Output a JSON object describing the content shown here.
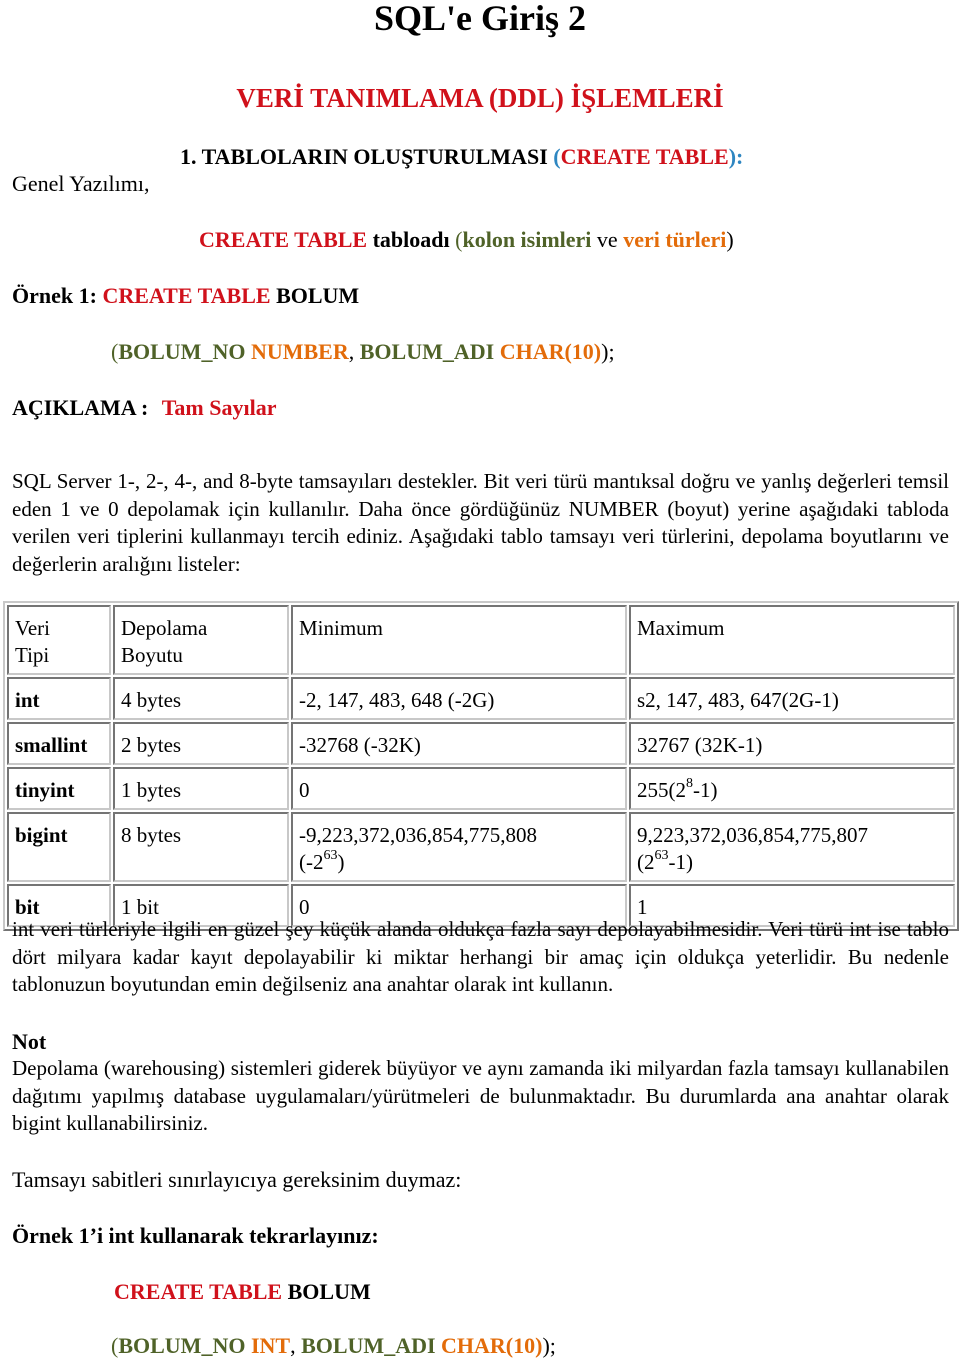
{
  "title": "SQL'e Giriş 2",
  "section_heading": "VERİ TANIMLAMA (DDL) İŞLEMLERİ",
  "subsection": {
    "number_text": "1. TABLOLARIN OLUŞTURULMASI ",
    "open_paren": "(",
    "keyword": "CREATE TABLE",
    "close_paren": ")",
    "colon": ":"
  },
  "general_syntax_label": "Genel Yazılımı,",
  "syntax": {
    "keyword": "CREATE TABLE",
    "table_word": " tabloadı ",
    "open_paren": "(",
    "columns_text": "kolon isimleri",
    "and_text": " ve ",
    "types_text": "veri türleri",
    "close_paren": ")"
  },
  "example1": {
    "label": "Örnek 1: ",
    "keyword": "CREATE TABLE",
    "table_name": " BOLUM",
    "line2": {
      "open_paren": "(",
      "col1": "BOLUM_NO",
      "type1": " NUMBER",
      "comma": ", ",
      "col2": "BOLUM_ADI",
      "type2": " CHAR(10)",
      "close": ");"
    }
  },
  "aciklama": {
    "label": "AÇIKLAMA : ",
    "value": "Tam Sayılar"
  },
  "paragraph1": "SQL Server 1-, 2-, 4-, and 8-byte tamsayıları destekler. Bit veri türü mantıksal doğru ve yanlış değerleri temsil eden 1 ve 0 depolamak için kullanılır. Daha önce gördüğünüz NUMBER (boyut) yerine aşağıdaki tabloda verilen veri tiplerini kullanmayı tercih ediniz. Aşağıdaki tablo tamsayı veri türlerini, depolama boyutlarını ve değerlerin aralığını listeler:",
  "table": {
    "headers": [
      "Veri Tipi",
      "Depolama Boyutu",
      "Minimum",
      "Maximum"
    ],
    "header_lines": [
      [
        "Veri",
        "Tipi"
      ],
      [
        "Depolama",
        "Boyutu"
      ],
      [
        "Minimum"
      ],
      [
        "Maximum"
      ]
    ],
    "rows": [
      {
        "type": "int",
        "size": "4 bytes",
        "min": "-2, 147, 483, 648 (-2G)",
        "max": "s2, 147, 483, 647(2G-1)"
      },
      {
        "type": "smallint",
        "size": "2 bytes",
        "min": "-32768 (-32K)",
        "max": "32767 (32K-1)"
      },
      {
        "type": "tinyint",
        "size": "1 bytes",
        "min": "0",
        "max_base": "255(2",
        "max_sup": "8",
        "max_tail": "-1)"
      },
      {
        "type": "bigint",
        "size": "8 bytes",
        "min_line1": "-9,223,372,036,854,775,808",
        "min_line2_base": "(-2",
        "min_line2_sup": "63",
        "min_line2_tail": ")",
        "max_line1": "9,223,372,036,854,775,807",
        "max_line2_base": "(2",
        "max_line2_sup": "63",
        "max_line2_tail": "-1)"
      },
      {
        "type": "bit",
        "size": "1 bit",
        "min": "0",
        "max": "1"
      }
    ]
  },
  "paragraph2": "int veri türleriyle ilgili en güzel şey küçük alanda oldukça fazla sayı depolayabilmesidir. Veri türü int ise tablo dört milyara kadar kayıt depolayabilir ki miktar herhangi bir amaç için oldukça yeterlidir. Bu nedenle tablonuzun boyutundan emin değilseniz ana anahtar olarak int kullanın.",
  "note": {
    "heading": "Not",
    "text": "Depolama (warehousing) sistemleri giderek büyüyor ve aynı zamanda iki milyardan fazla tamsayı kullanabilen dağıtımı yapılmış database uygulamaları/yürütmeleri de bulunmaktadır. Bu durumlarda ana anahtar olarak bigint kullanabilirsiniz."
  },
  "paragraph3": "Tamsayı sabitleri sınırlayıcıya gereksinim duymaz:",
  "example_repeat_label": "Örnek 1’i int kullanarak tekrarlayınız:",
  "example2": {
    "keyword": "CREATE TABLE",
    "table_name": " BOLUM",
    "line2": {
      "open_paren": "(",
      "col1": "BOLUM_NO",
      "type1": " INT",
      "comma": ", ",
      "col2": "BOLUM_ADI",
      "type2": " CHAR(10)",
      "close": ");"
    }
  },
  "colors": {
    "keyword_red": "#d0111b",
    "paren_blue": "#2e86c1",
    "column_green": "#4f6228",
    "type_orange": "#e36c0a",
    "table_border": "#c8c8c8"
  }
}
